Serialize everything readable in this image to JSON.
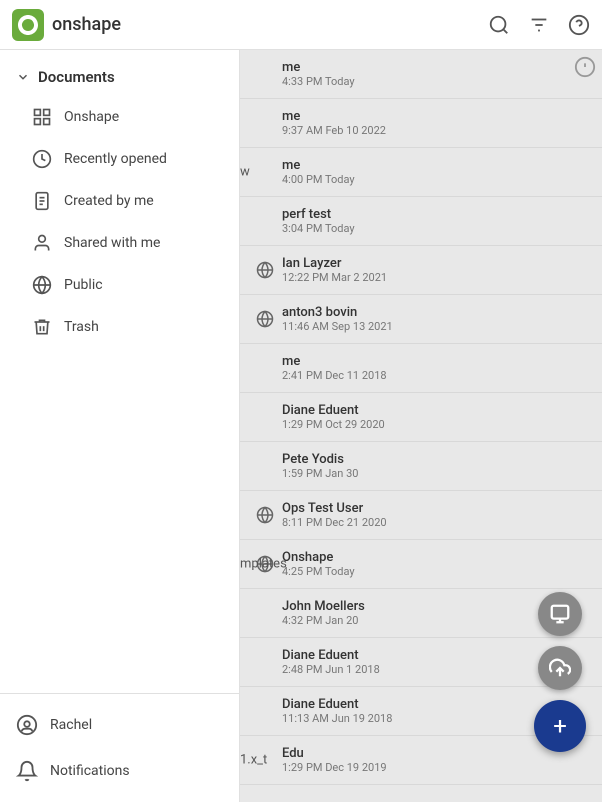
{
  "topbar": {
    "logo_text": "onshape"
  },
  "sidebar": {
    "header_label": "Documents",
    "items": [
      {
        "id": "onshape",
        "label": "Onshape",
        "icon": "grid"
      },
      {
        "id": "recently-opened",
        "label": "Recently opened",
        "icon": "clock"
      },
      {
        "id": "created-by-me",
        "label": "Created by me",
        "icon": "document"
      },
      {
        "id": "shared-with-me",
        "label": "Shared with me",
        "icon": "person"
      },
      {
        "id": "public",
        "label": "Public",
        "icon": "globe"
      },
      {
        "id": "trash",
        "label": "Trash",
        "icon": "trash"
      }
    ],
    "footer": [
      {
        "id": "profile",
        "label": "Rachel",
        "icon": "person-circle"
      },
      {
        "id": "notifications",
        "label": "Notifications",
        "icon": "bell"
      }
    ]
  },
  "content": {
    "items": [
      {
        "id": 1,
        "owner": "me",
        "date": "4:33 PM Today",
        "globe": false,
        "info": true
      },
      {
        "id": 2,
        "owner": "me",
        "date": "9:37 AM Feb 10 2022",
        "globe": false,
        "info": false
      },
      {
        "id": 3,
        "owner": "me",
        "date": "4:00 PM Today",
        "globe": false,
        "info": false
      },
      {
        "id": 4,
        "owner": "perf test",
        "date": "3:04 PM Today",
        "globe": false,
        "info": false
      },
      {
        "id": 5,
        "owner": "Ian Layzer",
        "date": "12:22 PM Mar 2 2021",
        "globe": true,
        "info": false
      },
      {
        "id": 6,
        "owner": "anton3 bovin",
        "date": "11:46 AM Sep 13 2021",
        "globe": true,
        "info": false
      },
      {
        "id": 7,
        "owner": "me",
        "date": "2:41 PM Dec 11 2018",
        "globe": false,
        "info": false
      },
      {
        "id": 8,
        "owner": "Diane Eduent",
        "date": "1:29 PM Oct 29 2020",
        "globe": false,
        "info": false
      },
      {
        "id": 9,
        "owner": "Pete Yodis",
        "date": "1:59 PM Jan 30",
        "globe": false,
        "info": false
      },
      {
        "id": 10,
        "owner": "Ops Test User",
        "date": "8:11 PM Dec 21 2020",
        "globe": true,
        "info": false
      },
      {
        "id": 11,
        "owner": "Onshape",
        "date": "4:25 PM Today",
        "globe": true,
        "info": false
      },
      {
        "id": 12,
        "owner": "John Moellers",
        "date": "4:32 PM Jan 20",
        "globe": false,
        "info": false
      },
      {
        "id": 13,
        "owner": "Diane Eduent",
        "date": "2:48 PM Jun 1 2018",
        "globe": false,
        "info": false
      },
      {
        "id": 14,
        "owner": "Diane Eduent",
        "date": "11:13 AM Jun 19 2018",
        "globe": false,
        "info": false
      },
      {
        "id": 15,
        "owner": "Edu",
        "date": "1:29 PM Dec 19 2019",
        "globe": false,
        "info": false
      }
    ],
    "partial_texts": [
      {
        "id": 3,
        "text": "w"
      },
      {
        "id": 11,
        "text": "mplates"
      },
      {
        "id": 15,
        "text": "1.x_t"
      }
    ]
  },
  "fabs": {
    "upload_label": "upload",
    "add_label": "add",
    "export_label": "export"
  }
}
